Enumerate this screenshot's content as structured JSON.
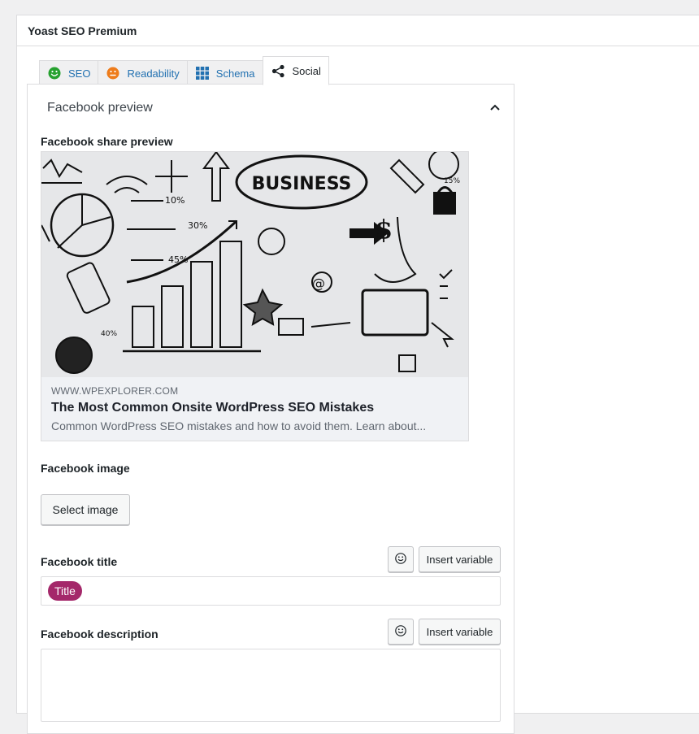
{
  "metabox": {
    "title": "Yoast SEO Premium"
  },
  "tabs": [
    {
      "label": "SEO",
      "icon": "smiley-green-icon"
    },
    {
      "label": "Readability",
      "icon": "smiley-orange-icon"
    },
    {
      "label": "Schema",
      "icon": "grid-icon"
    },
    {
      "label": "Social",
      "icon": "share-icon"
    }
  ],
  "colors": {
    "seo_status": "#26a12f",
    "readability_status": "#ee7c1b",
    "schema_icon": "#2271b1",
    "variable_pill": "#a4286a",
    "link": "#2271b1"
  },
  "facebook": {
    "section_title": "Facebook preview",
    "share_preview_label": "Facebook share preview",
    "preview": {
      "domain": "WWW.WPEXPLORER.COM",
      "title": "The Most Common Onsite WordPress SEO Mistakes",
      "description": "Common WordPress SEO mistakes and how to avoid them. Learn about..."
    },
    "image_label": "Facebook image",
    "select_image_button": "Select image",
    "title_label": "Facebook title",
    "title_variable": "Title",
    "insert_variable_button": "Insert variable",
    "description_label": "Facebook description",
    "description_value": ""
  },
  "preview_image_text": {
    "business": "BUSINESS",
    "ten_percent": "10%",
    "thirty_percent": "30%",
    "fortyfive_percent": "45%",
    "fifteen_percent": "15%",
    "forty_percent": "40%"
  }
}
